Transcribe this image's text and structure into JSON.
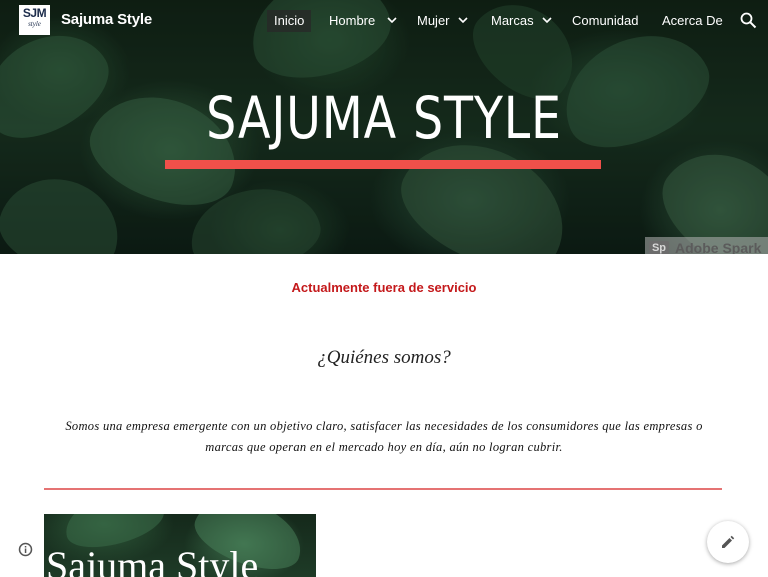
{
  "header": {
    "logo": {
      "main": "SJM",
      "sub": "style"
    },
    "site_title": "Sajuma Style",
    "nav": [
      {
        "label": "Inicio",
        "active": true,
        "has_dropdown": false
      },
      {
        "label": "Hombre",
        "active": false,
        "has_dropdown": true
      },
      {
        "label": "Mujer",
        "active": false,
        "has_dropdown": true
      },
      {
        "label": "Marcas",
        "active": false,
        "has_dropdown": true
      },
      {
        "label": "Comunidad",
        "active": false,
        "has_dropdown": false
      },
      {
        "label": "Acerca De",
        "active": false,
        "has_dropdown": false
      }
    ],
    "search_icon": "search-icon"
  },
  "hero": {
    "title": "SAJUMA STYLE",
    "accent_color": "#f0504a",
    "watermark": "Adobe Spark",
    "watermark_mark": "Sp"
  },
  "main": {
    "notice": "Actualmente fuera de servicio",
    "notice_color": "#c4191b",
    "heading": "¿Quiénes somos?",
    "body": "Somos una empresa emergente con un objetivo claro, satisfacer las necesidades de los consumidores que las empresas o marcas que operan en el mercado hoy en día, aún no logran cubrir.",
    "divider_color": "#e57373",
    "thumbnail_title": "Sajuma Style"
  },
  "footer": {
    "info_icon": "info-icon",
    "edit_icon": "pencil-icon"
  }
}
